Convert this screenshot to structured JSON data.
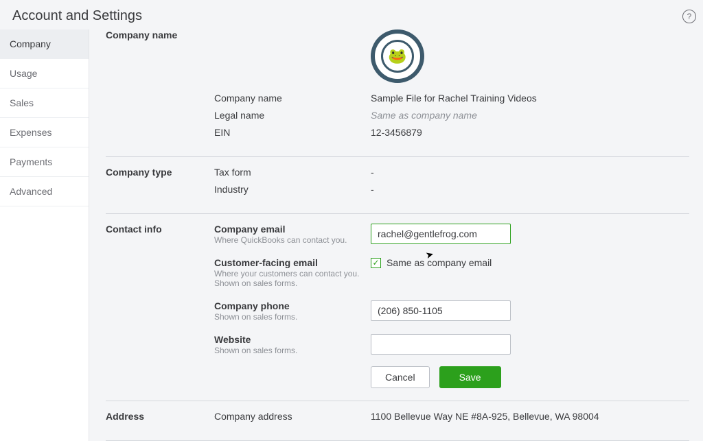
{
  "page_title": "Account and Settings",
  "sidebar": {
    "items": [
      {
        "label": "Company",
        "active": true
      },
      {
        "label": "Usage",
        "active": false
      },
      {
        "label": "Sales",
        "active": false
      },
      {
        "label": "Expenses",
        "active": false
      },
      {
        "label": "Payments",
        "active": false
      },
      {
        "label": "Advanced",
        "active": false
      }
    ]
  },
  "sections": {
    "company_name": {
      "title": "Company name",
      "fields": {
        "company_name": {
          "label": "Company name",
          "value": "Sample File for Rachel Training Videos"
        },
        "legal_name": {
          "label": "Legal name",
          "value": "Same as company name"
        },
        "ein": {
          "label": "EIN",
          "value": "12-3456879"
        }
      }
    },
    "company_type": {
      "title": "Company type",
      "fields": {
        "tax_form": {
          "label": "Tax form",
          "value": "-"
        },
        "industry": {
          "label": "Industry",
          "value": "-"
        }
      }
    },
    "contact_info": {
      "title": "Contact info",
      "fields": {
        "company_email": {
          "label": "Company email",
          "sub": "Where QuickBooks can contact you.",
          "value": "rachel@gentlefrog.com"
        },
        "customer_email": {
          "label": "Customer-facing email",
          "sub": "Where your customers can contact you. Shown on sales forms.",
          "checkbox_label": "Same as company email",
          "checked": true
        },
        "company_phone": {
          "label": "Company phone",
          "sub": "Shown on sales forms.",
          "value": "(206) 850-1105"
        },
        "website": {
          "label": "Website",
          "sub": "Shown on sales forms.",
          "value": ""
        }
      },
      "buttons": {
        "cancel": "Cancel",
        "save": "Save"
      }
    },
    "address": {
      "title": "Address",
      "fields": {
        "company_address": {
          "label": "Company address",
          "value": "1100 Bellevue Way NE #8A-925, Bellevue, WA 98004"
        }
      }
    }
  }
}
